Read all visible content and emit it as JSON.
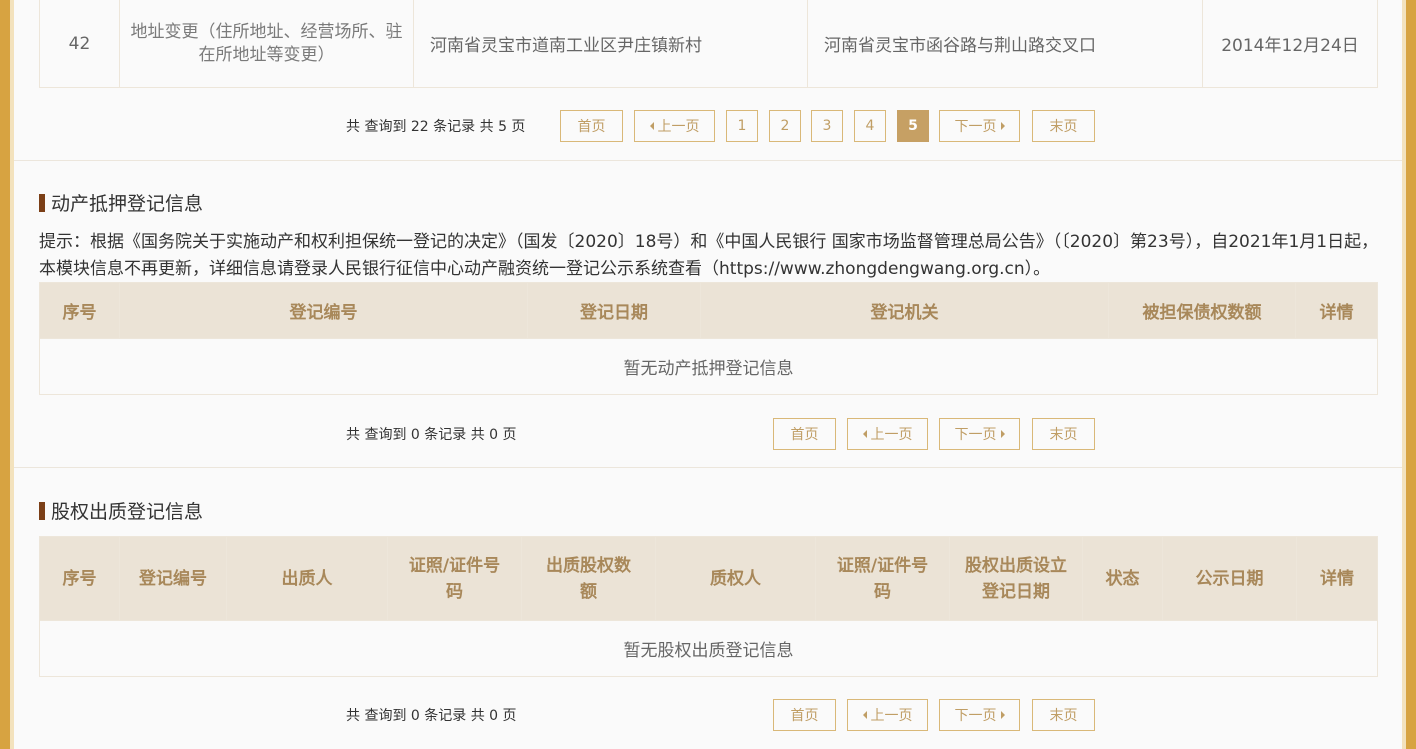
{
  "top_row": {
    "index": "42",
    "item": "地址变更（住所地址、经营场所、驻在所地址等变更）",
    "before": "河南省灵宝市道南工业区尹庄镇新村",
    "after": "河南省灵宝市函谷路与荆山路交叉口",
    "date": "2014年12月24日"
  },
  "pager1": {
    "summary": "共 查询到 22 条记录 共 5 页",
    "first": "首页",
    "prev": "上一页",
    "pages": [
      "1",
      "2",
      "3",
      "4",
      "5"
    ],
    "active_page": "5",
    "next": "下一页",
    "last": "末页"
  },
  "mortgage": {
    "title": "动产抵押登记信息",
    "notice": "提示：根据《国务院关于实施动产和权利担保统一登记的决定》（国发〔2020〕18号）和《中国人民银行 国家市场监督管理总局公告》（〔2020〕第23号），自2021年1月1日起，本模块信息不再更新，详细信息请登录人民银行征信中心动产融资统一登记公示系统查看（https://www.zhongdengwang.org.cn）。",
    "headers": [
      "序号",
      "登记编号",
      "登记日期",
      "登记机关",
      "被担保债权数额",
      "详情"
    ],
    "empty": "暂无动产抵押登记信息",
    "pager": {
      "summary": "共 查询到 0 条记录 共 0 页",
      "first": "首页",
      "prev": "上一页",
      "next": "下一页",
      "last": "末页"
    }
  },
  "equity": {
    "title": "股权出质登记信息",
    "headers": [
      "序号",
      "登记编号",
      "出质人",
      "证照/证件号码",
      "出质股权数额",
      "质权人",
      "证照/证件号码",
      "股权出质设立登记日期",
      "状态",
      "公示日期",
      "详情"
    ],
    "empty": "暂无股权出质登记信息",
    "pager": {
      "summary": "共 查询到 0 条记录 共 0 页",
      "first": "首页",
      "prev": "上一页",
      "next": "下一页",
      "last": "末页"
    }
  },
  "colors": {
    "frame": "#d7a341",
    "header_bg": "#ebe3d6",
    "header_text": "#a8885a",
    "active_page": "#c6a064",
    "title_bar": "#7b3f17"
  }
}
